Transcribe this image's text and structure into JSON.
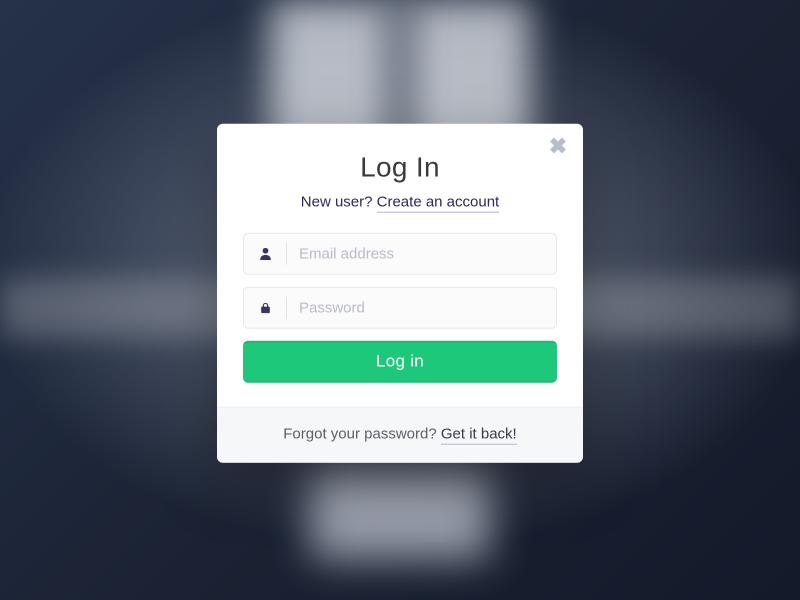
{
  "modal": {
    "title": "Log In",
    "sub_prefix": "New user? ",
    "create_account_link": "Create an account",
    "email_placeholder": "Email address",
    "password_placeholder": "Password",
    "submit_label": "Log in",
    "footer_prefix": "Forgot your password? ",
    "footer_link": "Get it back!"
  },
  "colors": {
    "accent": "#1ec87b",
    "link": "#2e2760"
  }
}
